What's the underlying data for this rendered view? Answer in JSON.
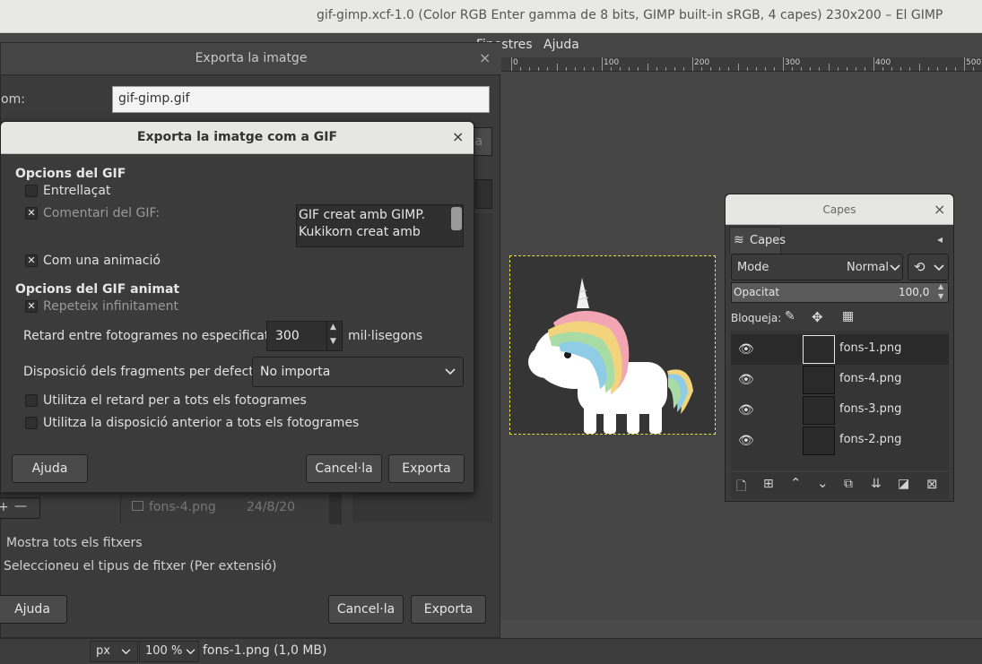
{
  "window": {
    "title": "gif-gimp.xcf-1.0 (Color RGB Enter gamma de 8 bits, GIMP built-in sRGB, 4 capes) 230x200 – El GIMP"
  },
  "menubar": {
    "items": [
      "Finestres",
      "Ajuda"
    ]
  },
  "ruler": {
    "labels": [
      "0",
      "100",
      "200",
      "300",
      "400",
      "500"
    ]
  },
  "export_dialog": {
    "title": "Exporta la imatge",
    "name_label": "om:",
    "name_value": "gif-gimp.gif",
    "edge_fragment": "ta",
    "files": [
      {
        "name": "fons-4.png",
        "date": "24/8/20"
      }
    ],
    "show_all_label": "Mostra tots els fitxers",
    "file_type_label": "Seleccioneu el tipus de fitxer (Per extensió)",
    "help_button": "Ajuda",
    "cancel_button": "Cancel·la",
    "export_button": "Exporta"
  },
  "gif_dialog": {
    "title": "Exporta la imatge com a GIF",
    "section_gif": "Opcions del GIF",
    "interlace_label": "Entrellaçat",
    "interlace_checked": false,
    "comment_label": "Comentari del GIF:",
    "comment_checked": true,
    "comment_text": "GIF creat amb GIMP.\nKukikorn creat amb",
    "as_animation_label": "Com una animació",
    "as_animation_checked": true,
    "section_anim": "Opcions del GIF animat",
    "loop_label": "Repeteix infinitament",
    "loop_checked": true,
    "delay_label": "Retard entre fotogrames no especificats:",
    "delay_value": "300",
    "delay_unit": "mil·lisegons",
    "disposal_label": "Disposició dels fragments per defecte:",
    "disposal_value": "No importa",
    "use_delay_label": "Utilitza el retard per a tots els fotogrames",
    "use_delay_checked": false,
    "use_disposal_label": "Utilitza la disposició anterior a tots els fotogrames",
    "use_disposal_checked": false,
    "help_button": "Ajuda",
    "cancel_button": "Cancel·la",
    "export_button": "Exporta"
  },
  "layers_panel": {
    "window_title": "Capes",
    "tab_label": "Capes",
    "mode_label": "Mode",
    "mode_value": "Normal",
    "opacity_label": "Opacitat",
    "opacity_value": "100,0",
    "lock_label": "Bloqueja:",
    "layers": [
      {
        "name": "fons-1.png",
        "selected": true
      },
      {
        "name": "fons-4.png",
        "selected": false
      },
      {
        "name": "fons-3.png",
        "selected": false
      },
      {
        "name": "fons-2.png",
        "selected": false
      }
    ]
  },
  "statusbar": {
    "unit": "px",
    "zoom": "100 %",
    "info": "fons-1.png (1,0 MB)"
  },
  "colors": {
    "selection_border": "#e8e044",
    "dialog_bg": "#3b3b3b",
    "titlebar_bg": "#e6e6e5"
  }
}
